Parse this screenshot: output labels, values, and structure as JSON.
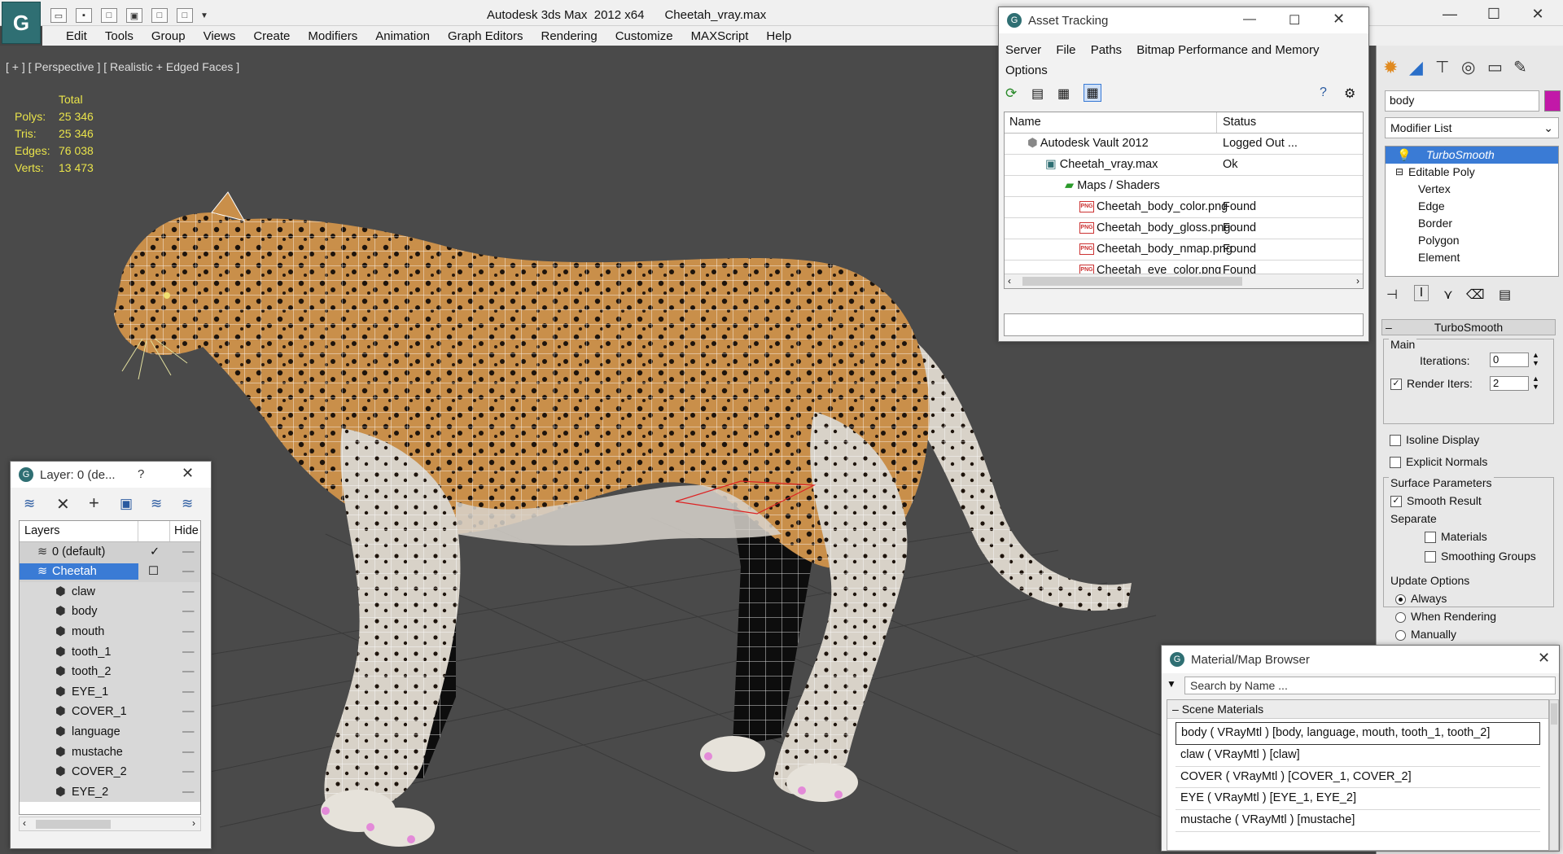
{
  "window": {
    "title": "Autodesk 3ds Max  2012 x64      Cheetah_vray.max",
    "logo_glyph": "G"
  },
  "menu": [
    "Edit",
    "Tools",
    "Group",
    "Views",
    "Create",
    "Modifiers",
    "Animation",
    "Graph Editors",
    "Rendering",
    "Customize",
    "MAXScript",
    "Help"
  ],
  "viewport": {
    "label": "[ + ] [ Perspective ] [ Realistic + Edged Faces ]",
    "stats": {
      "header": "Total",
      "rows": [
        {
          "label": "Polys:",
          "value": "25 346"
        },
        {
          "label": "Tris:",
          "value": "25 346"
        },
        {
          "label": "Edges:",
          "value": "76 038"
        },
        {
          "label": "Verts:",
          "value": "13 473"
        }
      ]
    }
  },
  "asset_tracking": {
    "title": "Asset Tracking",
    "menu": [
      "Server",
      "File",
      "Paths",
      "Bitmap Performance and Memory",
      "Options"
    ],
    "columns": [
      "Name",
      "Status"
    ],
    "rows": [
      {
        "name": "Autodesk Vault 2012",
        "status": "Logged Out ..."
      },
      {
        "name": "Cheetah_vray.max",
        "status": "Ok"
      },
      {
        "name": "Maps / Shaders",
        "status": ""
      },
      {
        "name": "Cheetah_body_color.png",
        "status": "Found"
      },
      {
        "name": "Cheetah_body_gloss.png",
        "status": "Found"
      },
      {
        "name": "Cheetah_body_nmap.png",
        "status": "Found"
      },
      {
        "name": "Cheetah_eye_color.png",
        "status": "Found"
      }
    ]
  },
  "layer_dialog": {
    "title": "Layer: 0 (de...",
    "help": "?",
    "columns": [
      "Layers",
      "Hide"
    ],
    "rows": [
      "0 (default)",
      "Cheetah",
      "claw",
      "body",
      "mouth",
      "tooth_1",
      "tooth_2",
      "EYE_1",
      "COVER_1",
      "language",
      "mustache",
      "COVER_2",
      "EYE_2"
    ]
  },
  "command_panel": {
    "object_name": "body",
    "object_color": "#c218a8",
    "modifier_list_label": "Modifier List",
    "stack": [
      "TurboSmooth",
      "Editable Poly",
      "Vertex",
      "Edge",
      "Border",
      "Polygon",
      "Element"
    ],
    "turbosmooth": {
      "title": "TurboSmooth",
      "main_label": "Main",
      "iterations_label": "Iterations:",
      "iterations_value": "0",
      "render_iters_label": "Render Iters:",
      "render_iters_value": "2",
      "isoline_label": "Isoline Display",
      "explicit_normals_label": "Explicit Normals",
      "surface_params_label": "Surface Parameters",
      "smooth_result_label": "Smooth Result",
      "separate_label": "Separate",
      "materials_label": "Materials",
      "smoothing_groups_label": "Smoothing Groups",
      "update_options_label": "Update Options",
      "always_label": "Always",
      "when_rendering_label": "When Rendering",
      "manually_label": "Manually"
    }
  },
  "material_browser": {
    "title": "Material/Map Browser",
    "search_placeholder": "Search by Name ...",
    "section": "Scene Materials",
    "items": [
      "body  ( VRayMtl ) [body, language, mouth, tooth_1, tooth_2]",
      "claw  ( VRayMtl ) [claw]",
      "COVER  ( VRayMtl ) [COVER_1, COVER_2]",
      "EYE  ( VRayMtl ) [EYE_1, EYE_2]",
      "mustache  ( VRayMtl ) [mustache]"
    ]
  }
}
